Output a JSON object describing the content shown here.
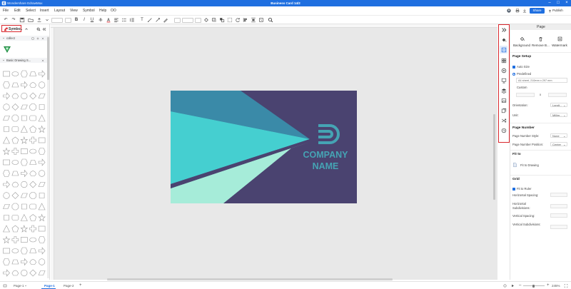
{
  "titlebar": {
    "app_name": "Wondershare EdrawMax",
    "doc_title": "Business Card 14/2",
    "minimize": "–",
    "maximize": "□",
    "close": "×"
  },
  "menu": {
    "items": [
      "File",
      "Edit",
      "Select",
      "Insert",
      "Layout",
      "View",
      "Symbol",
      "Help",
      "OO"
    ],
    "share_label": "Share",
    "publish_label": "Publish"
  },
  "toolbar": {
    "undo": "↶",
    "redo": "↷",
    "bold": "B",
    "italic": "I",
    "underline": "U",
    "text_tool": "T"
  },
  "left_panel": {
    "symbols_label": "Symbo..",
    "collect_label": "collect",
    "basic_drawing_label": "Basic Drawing S..."
  },
  "card": {
    "company_line1": "COMPANY",
    "company_line2": "NAME",
    "colors": {
      "background": "#4a4370",
      "teal_dark": "#3a8aa8",
      "teal": "#45cfd0",
      "mint": "#a6ecd9",
      "logo": "#45a4b4"
    }
  },
  "right_panel": {
    "header": "Page",
    "tools": {
      "background": "Background",
      "remove_bg": "Remove B...",
      "watermark": "Watermark"
    },
    "page_setup": {
      "title": "Page Setup",
      "auto_size": "Auto Size",
      "predefined": "Predefined",
      "paper_size": "A4 sheet, 210mm x 297 mm",
      "custom": "Custom",
      "times": "x",
      "orientation_label": "Orientation:",
      "orientation_value": "Landt...",
      "unit_label": "Unit:",
      "unit_value": "Millim..."
    },
    "page_number": {
      "title": "Page Number",
      "style_label": "Page Number Style:",
      "style_value": "None",
      "position_label": "Page Number Position:",
      "position_value": "Center"
    },
    "fit_to": {
      "title": "Fit to",
      "fit_drawing": "Fit to Drawing"
    },
    "grid": {
      "title": "Grid",
      "fit_to_ruler": "Fit to Ruler",
      "horizontal_spacing": "Horizontal Spacing:",
      "horizontal_subdivisions": "Horizontal Subdivisions:",
      "vertical_spacing": "Vertical Spacing:",
      "vertical_subdivisions": "Vertical Subdivisions:"
    }
  },
  "statusbar": {
    "page_selector": "Page-1",
    "tab_active": "Page-1",
    "tab_other": "Page-2",
    "add": "+",
    "zoom": "245%",
    "zoom_minus": "–",
    "zoom_plus": "+"
  },
  "accent_color": "#1f6fe0",
  "highlight_color": "#d9262c"
}
